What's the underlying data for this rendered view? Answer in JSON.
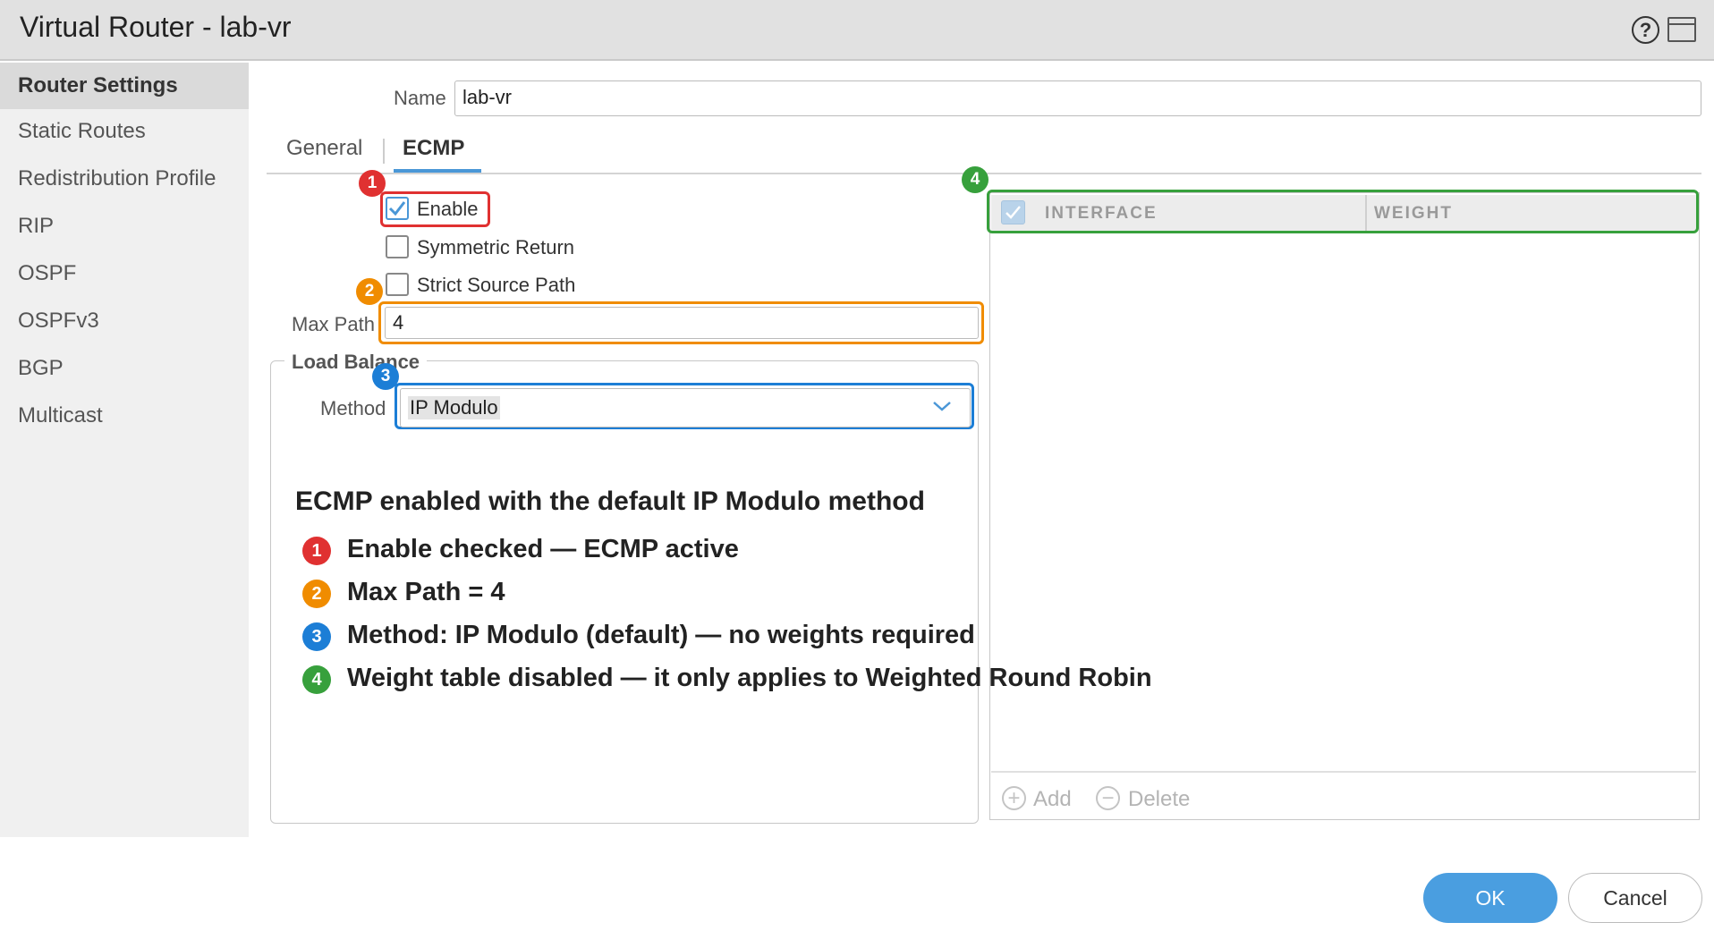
{
  "window": {
    "title": "Virtual Router - lab-vr",
    "help_icon": "?"
  },
  "sidebar": {
    "items": [
      {
        "label": "Router Settings",
        "active": true
      },
      {
        "label": "Static Routes"
      },
      {
        "label": "Redistribution Profile"
      },
      {
        "label": "RIP"
      },
      {
        "label": "OSPF"
      },
      {
        "label": "OSPFv3"
      },
      {
        "label": "BGP"
      },
      {
        "label": "Multicast"
      }
    ]
  },
  "form": {
    "name_label": "Name",
    "name_value": "lab-vr"
  },
  "tabs": [
    {
      "label": "General"
    },
    {
      "label": "ECMP",
      "active": true
    }
  ],
  "ecmp": {
    "enable": {
      "label": "Enable",
      "checked": true
    },
    "symmetric_return": {
      "label": "Symmetric Return",
      "checked": false
    },
    "strict_source_path": {
      "label": "Strict Source Path",
      "checked": false
    },
    "max_path_label": "Max Path",
    "max_path_value": "4",
    "load_balance": {
      "legend": "Load Balance",
      "method_label": "Method",
      "method_value": "IP Modulo"
    }
  },
  "weight_table": {
    "columns": [
      "INTERFACE",
      "WEIGHT"
    ],
    "rows": [],
    "add_label": "Add",
    "delete_label": "Delete"
  },
  "annotations": {
    "title": "ECMP enabled with the default IP Modulo method",
    "items": [
      {
        "num": "1",
        "text": "Enable checked — ECMP active",
        "color": "#e03131"
      },
      {
        "num": "2",
        "text": "Max Path = 4",
        "color": "#f08c00"
      },
      {
        "num": "3",
        "text": "Method: IP Modulo (default) — no weights required",
        "color": "#1c7ed6"
      },
      {
        "num": "4",
        "text": "Weight table disabled — it only applies to Weighted Round Robin",
        "color": "#37a03c"
      }
    ]
  },
  "buttons": {
    "ok": "OK",
    "cancel": "Cancel"
  },
  "colors": {
    "accent": "#4a97d7",
    "ok_button": "#4a9ee0"
  }
}
